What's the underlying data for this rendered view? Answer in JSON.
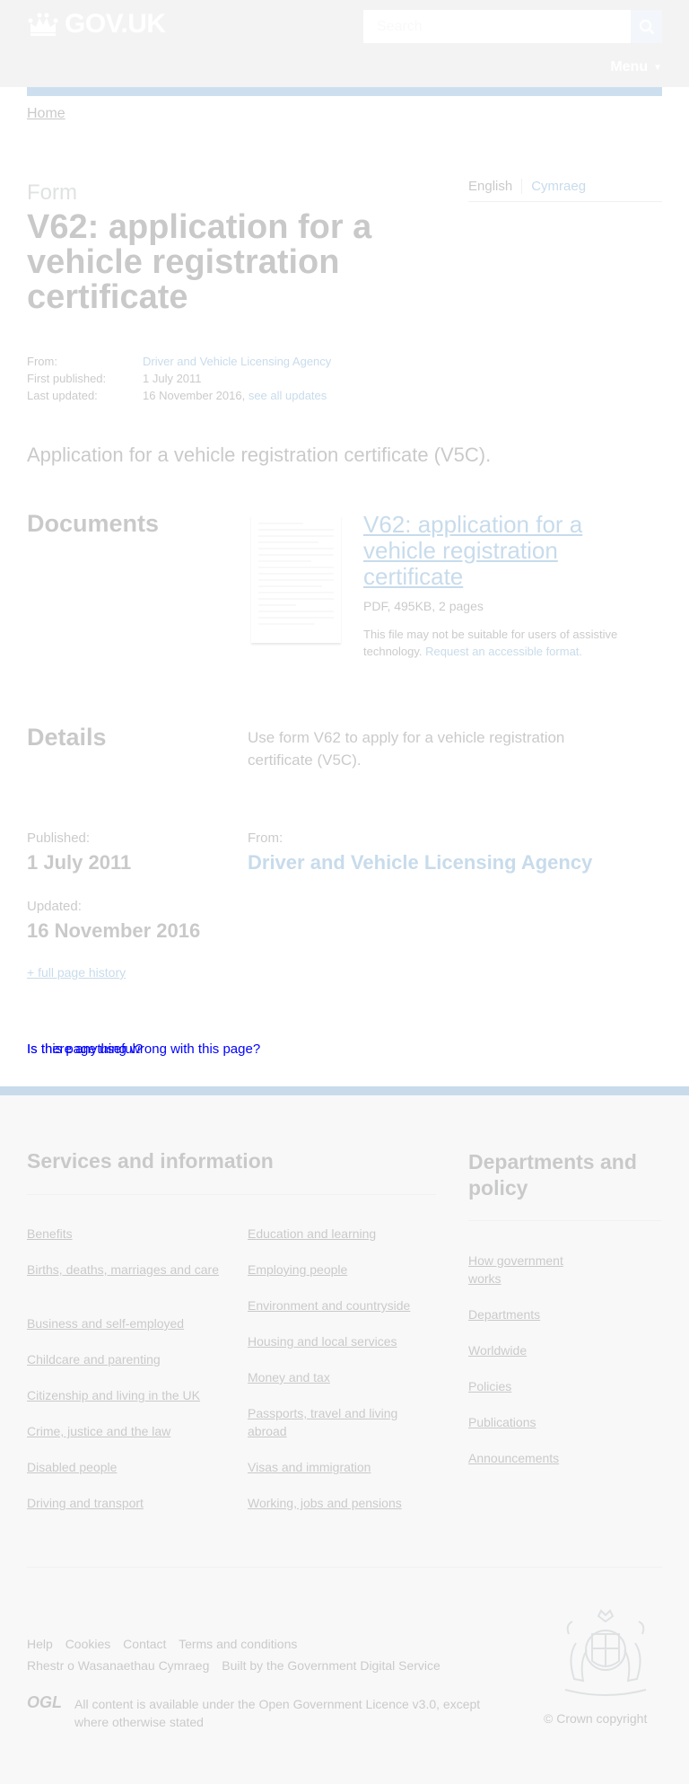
{
  "header": {
    "logo_text": "GOV.UK",
    "search_placeholder": "Search",
    "menu_label": "Menu"
  },
  "breadcrumb": {
    "home": "Home"
  },
  "title_block": {
    "caption": "Form",
    "title": "V62: application for a vehicle registration certificate"
  },
  "language": {
    "english": "English",
    "welsh": "Cymraeg"
  },
  "metadata": {
    "from_label": "From:",
    "from_value": "Driver and Vehicle Licensing Agency",
    "first_published_label": "First published:",
    "first_published_value": "1 July 2011",
    "last_updated_label": "Last updated:",
    "last_updated_value": "16 November 2016,",
    "see_all_updates": "see all updates"
  },
  "lead": "Application for a vehicle registration certificate (V5C).",
  "documents": {
    "heading": "Documents",
    "doc_title": "V62: application for a vehicle registration certificate",
    "doc_meta": "PDF, 495KB, 2 pages",
    "note": "This file may not be suitable for users of assistive technology.",
    "request_link": "Request an accessible format."
  },
  "details": {
    "heading": "Details",
    "text": "Use form V62 to apply for a vehicle registration certificate (V5C).",
    "published_label": "Published:",
    "published_value": "1 July 2011",
    "from_label": "From:",
    "from_value": "Driver and Vehicle Licensing Agency",
    "updated_label": "Updated:",
    "updated_value": "16 November 2016",
    "history_link": "+ full page history"
  },
  "feedback": {
    "line1": "Is this page useful?",
    "line2": "Is there anything wrong with this page?"
  },
  "footer": {
    "services_heading": "Services and information",
    "departments_heading": "Departments and policy",
    "services_col1": [
      "Benefits",
      "Births, deaths, marriages and care",
      "Business and self-employed",
      "Childcare and parenting",
      "Citizenship and living in the UK",
      "Crime, justice and the law",
      "Disabled people",
      "Driving and transport"
    ],
    "services_col2": [
      "Education and learning",
      "Employing people",
      "Environment and countryside",
      "Housing and local services",
      "Money and tax",
      "Passports, travel and living abroad",
      "Visas and immigration",
      "Working, jobs and pensions"
    ],
    "departments": [
      "How government works",
      "Departments",
      "Worldwide",
      "Policies",
      "Publications",
      "Announcements"
    ],
    "meta_links": [
      "Help",
      "Cookies",
      "Contact",
      "Terms and conditions"
    ],
    "welsh_link": "Rhestr o Wasanaethau Cymraeg",
    "built_by": "Built by the",
    "gds_link": "Government Digital Service",
    "ogl": "OGL",
    "licence_prefix": "All content is available under the",
    "licence_link": "Open Government Licence v3.0",
    "licence_suffix": ", except where otherwise stated",
    "copyright": "© Crown copyright"
  },
  "colors": {
    "header_bg": "#0b0c0c",
    "link": "#005ea5",
    "footer_bg": "#dee0e2"
  }
}
